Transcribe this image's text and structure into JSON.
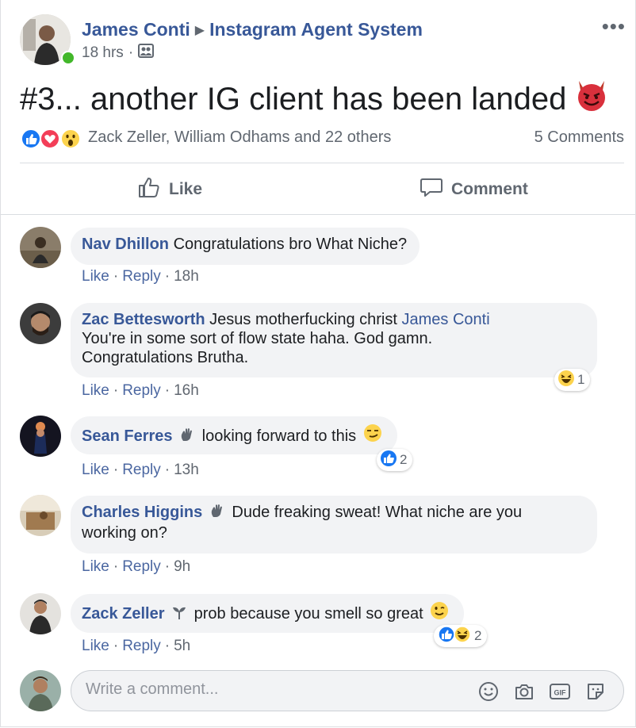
{
  "post": {
    "author": "James Conti",
    "group": "Instagram Agent System",
    "time": "18 hrs",
    "dot": "·",
    "text": "#3... another IG client has been landed",
    "emoji": "smiling-devil-emoji"
  },
  "reactions": {
    "types": [
      "like",
      "love",
      "wow"
    ],
    "names": "Zack Zeller, William Odhams and 22 others",
    "comments": "5 Comments"
  },
  "actions": {
    "like": "Like",
    "comment": "Comment"
  },
  "comment_actions": {
    "like": "Like",
    "reply": "Reply",
    "sep": "·"
  },
  "comments": [
    {
      "name": "Nav Dhillon",
      "text": "Congratulations bro What Niche?",
      "time": "18h"
    },
    {
      "name": "Zac Bettesworth",
      "text": "Jesus motherfucking christ",
      "mention": "James Conti",
      "text2": "You're in some sort of flow state haha. God gamn.",
      "text3": "Congratulations Brutha.",
      "time": "16h",
      "reaction_count": "1",
      "reaction_types": [
        "haha"
      ]
    },
    {
      "name": "Sean Ferres",
      "badge": "waving-hand-icon",
      "text": "looking forward to this",
      "time": "13h",
      "reaction_count": "2",
      "reaction_types": [
        "like"
      ]
    },
    {
      "name": "Charles Higgins",
      "badge": "waving-hand-icon",
      "text": "Dude freaking sweat! What niche are you",
      "text2": "working on?",
      "time": "9h"
    },
    {
      "name": "Zack Zeller",
      "badge": "sprout-icon",
      "text": "prob because you smell so great",
      "time": "5h",
      "reaction_count": "2",
      "reaction_types": [
        "like",
        "haha"
      ]
    }
  ],
  "composer": {
    "placeholder": "Write a comment...",
    "tools": [
      "emoji-icon",
      "camera-icon",
      "gif-icon",
      "sticker-icon"
    ]
  },
  "colors": {
    "link": "#385898",
    "muted": "#606770",
    "like": "#1877f2",
    "love": "#f33e58",
    "bubble": "#f2f3f5"
  }
}
